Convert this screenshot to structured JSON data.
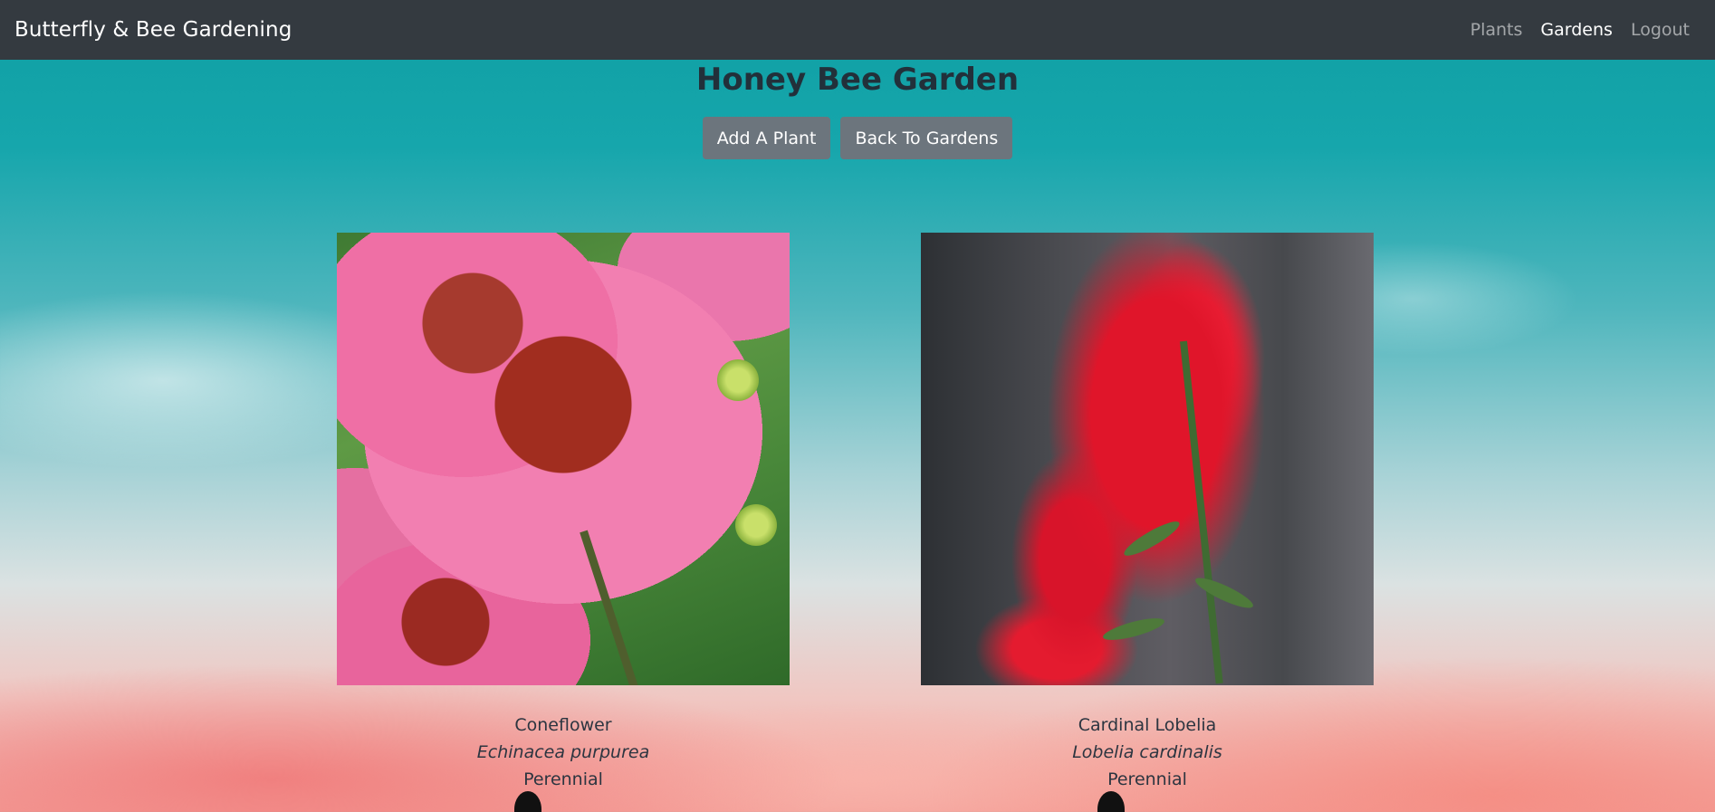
{
  "navbar": {
    "brand": "Butterfly & Bee Gardening",
    "links": [
      {
        "label": "Plants",
        "active": false
      },
      {
        "label": "Gardens",
        "active": true
      },
      {
        "label": "Logout",
        "active": false
      }
    ]
  },
  "page": {
    "title": "Honey Bee Garden",
    "add_button": "Add A Plant",
    "back_button": "Back To Gardens"
  },
  "plants": [
    {
      "common_name": "Coneflower",
      "scientific_name": "Echinacea purpurea",
      "life_cycle": "Perennial"
    },
    {
      "common_name": "Cardinal Lobelia",
      "scientific_name": "Lobelia cardinalis",
      "life_cycle": "Perennial"
    }
  ],
  "colors": {
    "navbar_bg": "#343a40",
    "button_bg": "#6c757d",
    "title_text": "#22303a"
  }
}
